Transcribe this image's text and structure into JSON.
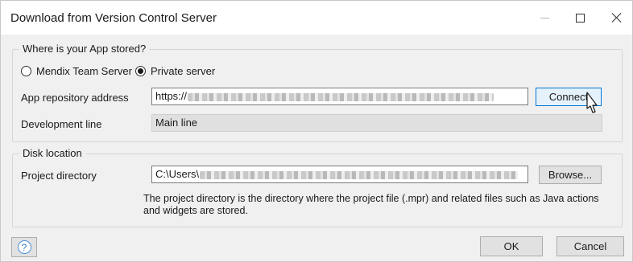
{
  "window": {
    "title": "Download from Version Control Server"
  },
  "storage": {
    "legend": "Where is your App stored?",
    "options": [
      {
        "label": "Mendix Team Server",
        "selected": false
      },
      {
        "label": "Private server",
        "selected": true
      }
    ],
    "repo_label": "App repository address",
    "repo_value": "https://",
    "connect_label": "Connect",
    "devline_label": "Development line",
    "devline_value": "Main line"
  },
  "disk": {
    "legend": "Disk location",
    "dir_label": "Project directory",
    "dir_value": "C:\\Users\\",
    "browse_label": "Browse...",
    "help": "The project directory is the directory where the project file (.mpr) and related files such as Java actions and widgets are stored."
  },
  "footer": {
    "ok_label": "OK",
    "cancel_label": "Cancel"
  },
  "colors": {
    "accent": "#0078d7",
    "help_icon": "#2f79c8"
  },
  "icons": [
    "minimize-icon",
    "maximize-icon",
    "close-icon",
    "help-icon",
    "cursor-icon"
  ]
}
